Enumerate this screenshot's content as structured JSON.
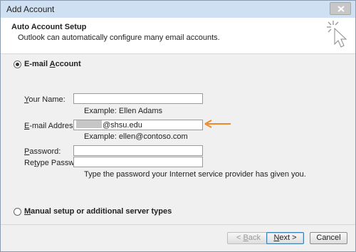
{
  "window": {
    "title": "Add Account"
  },
  "header": {
    "title": "Auto Account Setup",
    "subtitle": "Outlook can automatically configure many email accounts."
  },
  "options": {
    "email_account": {
      "label": "E-mail Account",
      "selected": true
    },
    "manual_setup": {
      "label": "Manual setup or additional server types",
      "selected": false
    }
  },
  "form": {
    "your_name": {
      "label": "Your Name:",
      "value": "",
      "example": "Example: Ellen Adams"
    },
    "email": {
      "label": "E-mail Address:",
      "value": "@shsu.edu",
      "example": "Example: ellen@contoso.com"
    },
    "password": {
      "label": "Password:",
      "value": ""
    },
    "retype_password": {
      "label": "Retype Password:",
      "value": ""
    },
    "password_hint": "Type the password your Internet service provider has given you."
  },
  "buttons": {
    "back": "< Back",
    "next": "Next >",
    "cancel": "Cancel"
  },
  "colors": {
    "arrow": "#ec8a2b",
    "titlebar": "#cfe0f2"
  },
  "icons": {
    "wizard": "wand-cursor-icon",
    "close": "close-icon"
  }
}
